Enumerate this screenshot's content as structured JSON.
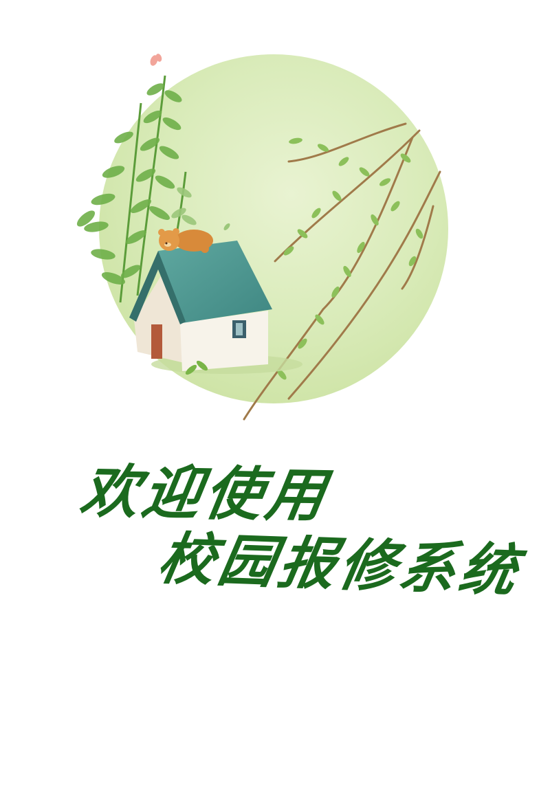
{
  "welcome": {
    "line1": "欢迎使用",
    "line2": "校园报修系统"
  },
  "illustration": {
    "icon": "house-in-circle-illustration"
  },
  "colors": {
    "text": "#1b6a1e",
    "circle": "#d6e9b4",
    "roof": "#4f9a94",
    "leaf": "#6fb04a"
  }
}
